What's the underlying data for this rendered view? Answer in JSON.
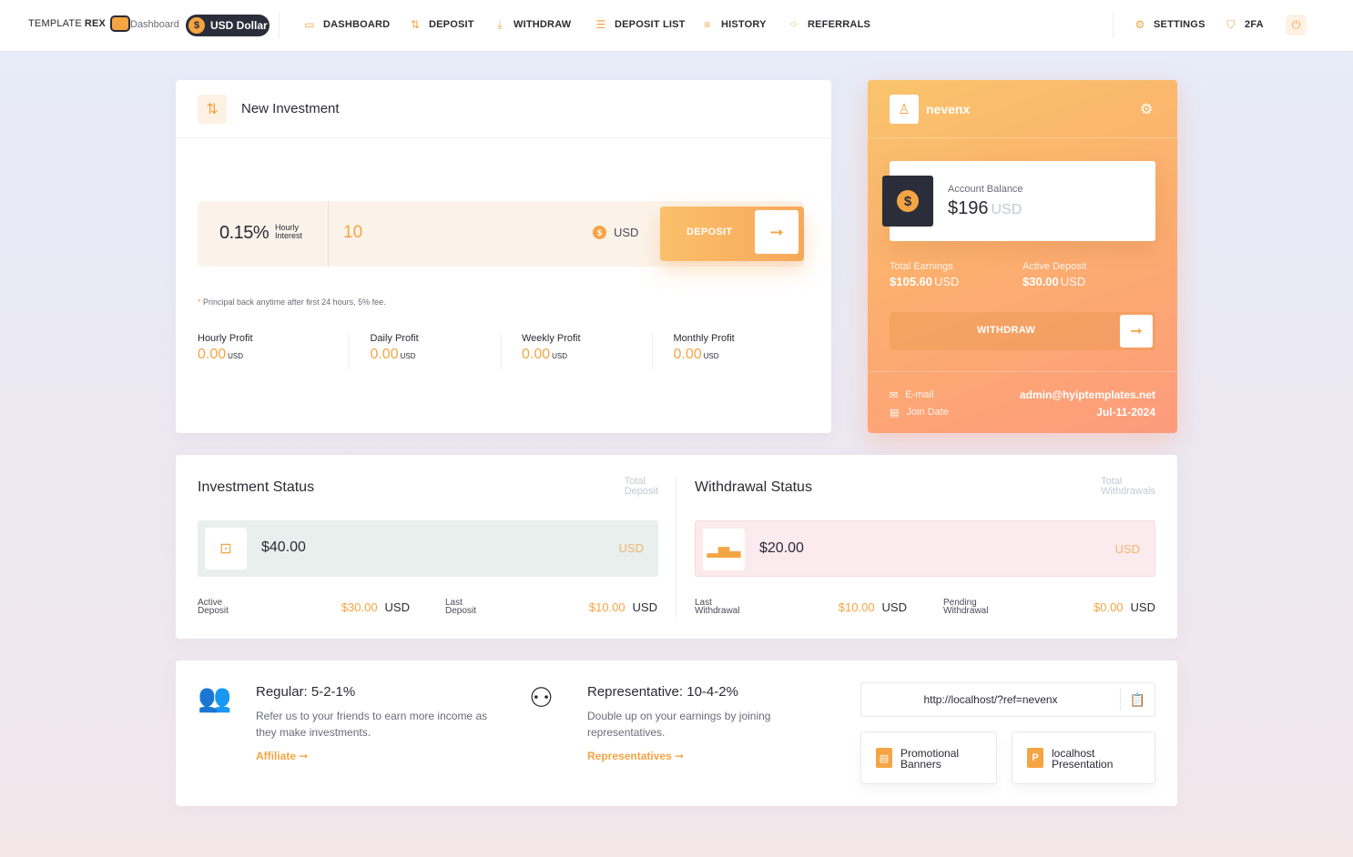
{
  "brand": {
    "text_light": "TEMPLATE",
    "text_bold": "REX"
  },
  "nav": {
    "dashboard_link": "Dashboard",
    "currency": {
      "symbol": "$",
      "label": "USD Dollar"
    },
    "items": [
      {
        "label": "DASHBOARD",
        "icon": "layout-icon",
        "glyph": "▭"
      },
      {
        "label": "DEPOSIT",
        "icon": "sort-icon",
        "glyph": "⇅"
      },
      {
        "label": "WITHDRAW",
        "icon": "download-icon",
        "glyph": "⤓"
      },
      {
        "label": "DEPOSIT LIST",
        "icon": "list-icon",
        "glyph": "☰"
      },
      {
        "label": "HISTORY",
        "icon": "history-icon",
        "glyph": "≡"
      },
      {
        "label": "REFERRALS",
        "icon": "grid-icon",
        "glyph": "⁘"
      }
    ],
    "settings": "SETTINGS",
    "twofa": "2FA"
  },
  "investment": {
    "title": "New Investment",
    "rate": "0.15%",
    "rate_sub_1": "Hourly",
    "rate_sub_2": "Interest",
    "amount": "10",
    "currency_symbol": "$",
    "currency": "USD",
    "deposit_label": "DEPOSIT",
    "note_star": "*",
    "note": "Principal back anytime after first 24 hours, 5% fee.",
    "profits": [
      {
        "label": "Hourly Profit",
        "value": "0.00",
        "unit": "USD"
      },
      {
        "label": "Daily Profit",
        "value": "0.00",
        "unit": "USD"
      },
      {
        "label": "Weekly Profit",
        "value": "0.00",
        "unit": "USD"
      },
      {
        "label": "Monthly Profit",
        "value": "0.00",
        "unit": "USD"
      }
    ]
  },
  "account": {
    "username": "nevenx",
    "balance_label": "Account Balance",
    "balance_symbol": "$",
    "balance": "$196",
    "balance_unit": "USD",
    "total_earnings_label": "Total Earnings",
    "total_earnings": "$105.60",
    "active_deposit_label": "Active Deposit",
    "active_deposit": "$30.00",
    "unit": "USD",
    "withdraw_label": "WITHDRAW",
    "email_label": "E-mail",
    "email": "admin@hyiptemplates.net",
    "join_label": "Join Date",
    "join_date": "Jul-11-2024"
  },
  "investment_status": {
    "title": "Investment Status",
    "tag_1": "Total",
    "tag_2": "Deposit",
    "amount": "$40.00",
    "currency": "USD",
    "sub": [
      {
        "label_1": "Active",
        "label_2": "Deposit",
        "value": "$30.00",
        "unit": "USD"
      },
      {
        "label_1": "Last",
        "label_2": "Deposit",
        "value": "$10.00",
        "unit": "USD"
      }
    ],
    "bar_color": "#e8efec"
  },
  "withdrawal_status": {
    "title": "Withdrawal Status",
    "tag_1": "Total",
    "tag_2": "Withdrawals",
    "amount": "$20.00",
    "currency": "USD",
    "sub": [
      {
        "label_1": "Last",
        "label_2": "Withdrawal",
        "value": "$10.00",
        "unit": "USD"
      },
      {
        "label_1": "Pending",
        "label_2": "Withdrawal",
        "value": "$0.00",
        "unit": "USD"
      }
    ],
    "bar_color": "#fbeaee"
  },
  "referrals": {
    "regular": {
      "title": "Regular: 5-2-1%",
      "desc": "Refer us to your friends to earn more income as they make investments.",
      "link": "Affiliate ➞"
    },
    "representative": {
      "title": "Representative: 10-4-2%",
      "desc": "Double up on your earnings by joining representatives.",
      "link": "Representatives ➞"
    },
    "ref_url": "http://localhost/?ref=nevenx",
    "banners": "Promotional Banners",
    "presentation": "localhost Presentation",
    "presentation_glyph": "P"
  },
  "colors": {
    "accent": "#f5a443",
    "dark": "#2b2d3a"
  }
}
